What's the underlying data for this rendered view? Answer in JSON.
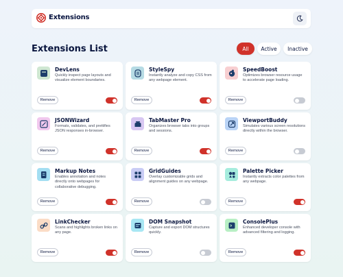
{
  "app": {
    "brand": "Extensions"
  },
  "page": {
    "title": "Extensions List"
  },
  "filters": [
    {
      "label": "All",
      "active": true
    },
    {
      "label": "Active",
      "active": false
    },
    {
      "label": "Inactive",
      "active": false
    }
  ],
  "remove_label": "Remove",
  "colors": {
    "accent": "#d0322a",
    "toggle_off": "#c7cbd3",
    "text": "#09153e"
  },
  "extensions": [
    {
      "name": "DevLens",
      "description": "Quickly inspect page layouts and visualize element boundaries.",
      "enabled": true,
      "icon": "devlens-icon",
      "icon_bg": "#cfe7d2",
      "icon_color": "#1c3d6b"
    },
    {
      "name": "StyleSpy",
      "description": "Instantly analyze and copy CSS from any webpage element.",
      "enabled": true,
      "icon": "stylespy-icon",
      "icon_bg": "#b6dbe4",
      "icon_color": "#1c3d6b"
    },
    {
      "name": "SpeedBoost",
      "description": "Optimizes browser resource usage to accelerate page loading.",
      "enabled": false,
      "icon": "speedboost-icon",
      "icon_bg": "#f8cfd1",
      "icon_color": "#1c3d6b"
    },
    {
      "name": "JSONWizard",
      "description": "Formats, validates, and prettifies JSON responses in-browser.",
      "enabled": true,
      "icon": "jsonwizard-icon",
      "icon_bg": "#f1c8ee",
      "icon_color": "#1c3d6b"
    },
    {
      "name": "TabMaster Pro",
      "description": "Organizes browser tabs into groups and sessions.",
      "enabled": true,
      "icon": "tabmaster-icon",
      "icon_bg": "#d8c7f2",
      "icon_color": "#1c3d6b"
    },
    {
      "name": "ViewportBuddy",
      "description": "Simulates various screen resolutions directly within the browser.",
      "enabled": false,
      "icon": "viewportbuddy-icon",
      "icon_bg": "#b9d3f6",
      "icon_color": "#1c3d6b"
    },
    {
      "name": "Markup Notes",
      "description": "Enables annotation and notes directly onto webpages for collaborative debugging.",
      "enabled": true,
      "icon": "markup-notes-icon",
      "icon_bg": "#a3def2",
      "icon_color": "#1c3d6b"
    },
    {
      "name": "GridGuides",
      "description": "Overlay customizable grids and alignment guides on any webpage.",
      "enabled": false,
      "icon": "gridguides-icon",
      "icon_bg": "#c9ccf5",
      "icon_color": "#1c3d6b"
    },
    {
      "name": "Palette Picker",
      "description": "Instantly extracts color palettes from any webpage.",
      "enabled": true,
      "icon": "palette-picker-icon",
      "icon_bg": "#a6ecdd",
      "icon_color": "#1c3d6b"
    },
    {
      "name": "LinkChecker",
      "description": "Scans and highlights broken links on any page.",
      "enabled": true,
      "icon": "linkchecker-icon",
      "icon_bg": "#fbdcc6",
      "icon_color": "#1c3d6b"
    },
    {
      "name": "DOM Snapshot",
      "description": "Capture and export DOM structures quickly.",
      "enabled": false,
      "icon": "dom-snapshot-icon",
      "icon_bg": "#a8e7f3",
      "icon_color": "#1c3d6b"
    },
    {
      "name": "ConsolePlus",
      "description": "Enhanced developer console with advanced filtering and logging.",
      "enabled": true,
      "icon": "consoleplus-icon",
      "icon_bg": "#b8efc4",
      "icon_color": "#1c3d6b"
    }
  ]
}
